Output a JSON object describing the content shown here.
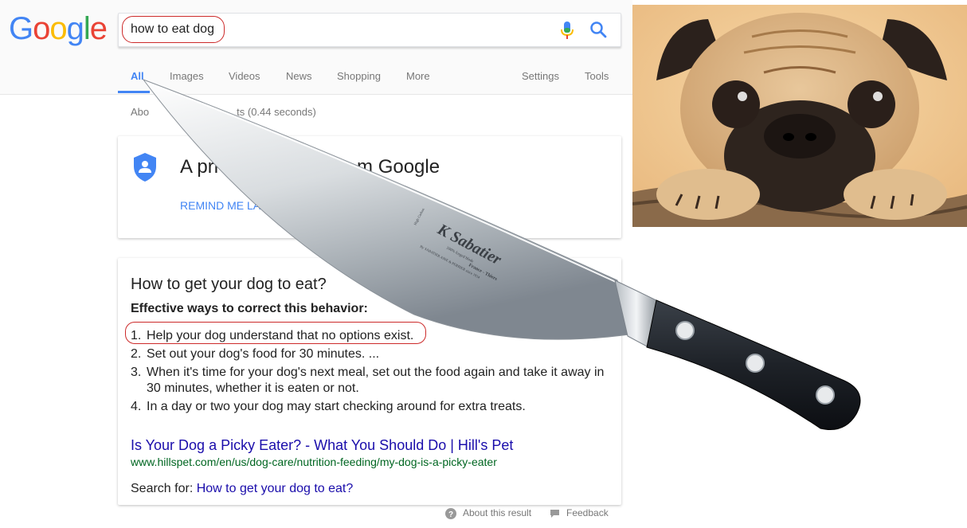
{
  "logo": {
    "text": "Google",
    "letters": [
      {
        "ch": "G",
        "color": "#4285f4"
      },
      {
        "ch": "o",
        "color": "#ea4335"
      },
      {
        "ch": "o",
        "color": "#fbbc05"
      },
      {
        "ch": "g",
        "color": "#4285f4"
      },
      {
        "ch": "l",
        "color": "#34a853"
      },
      {
        "ch": "e",
        "color": "#ea4335"
      }
    ]
  },
  "search": {
    "query": "how to eat dog"
  },
  "icons": {
    "mic": "microphone-icon",
    "search": "search-icon",
    "shield": "shield-person-icon",
    "help": "question-circle-icon",
    "feedback": "feedback-flag-icon"
  },
  "tabs": [
    {
      "label": "All",
      "active": true
    },
    {
      "label": "Images"
    },
    {
      "label": "Videos"
    },
    {
      "label": "News"
    },
    {
      "label": "Shopping"
    },
    {
      "label": "More"
    },
    {
      "label": "Settings"
    },
    {
      "label": "Tools"
    }
  ],
  "stats": {
    "prefix": "Abo",
    "suffix": "ts (0.44 seconds)"
  },
  "privacy": {
    "title_start": "A pri",
    "title_end": "m Google",
    "remind": "REMIND ME LATE"
  },
  "snippet": {
    "question": "How to get your dog to eat?",
    "subtitle": "Effective ways to correct this behavior:",
    "steps": [
      {
        "num": "1.",
        "text": "Help your dog understand that no options exist."
      },
      {
        "num": "2.",
        "text": "Set out your dog's food for 30 minutes. ..."
      },
      {
        "num": "3.",
        "text": "When it's time for your dog's next meal, set out the food again and take it away in 30 minutes, whether it is eaten or not."
      },
      {
        "num": "4.",
        "text": "In a day or two your dog may start checking around for extra treats."
      }
    ],
    "result_title": "Is Your Dog a Picky Eater? - What You Should Do | Hill's Pet",
    "result_url": "www.hillspet.com/en/us/dog-care/nutrition-feeding/my-dog-is-a-picky-eater",
    "search_for_label": "Search for: ",
    "search_for_link": "How to get your dog to eat?"
  },
  "footer": {
    "about": "About this result",
    "feedback": "Feedback"
  },
  "knife": {
    "brand": "K Sabatier",
    "line1": "100% forged blade",
    "line2": "France - Thiers",
    "line3": "By SABATIER AINE & PERRIER since 1834",
    "mark": "High Carbon"
  },
  "colors": {
    "google_blue": "#4285f4",
    "link": "#1a0dab",
    "url_green": "#006621",
    "annotation_red": "#cc2a2a"
  }
}
